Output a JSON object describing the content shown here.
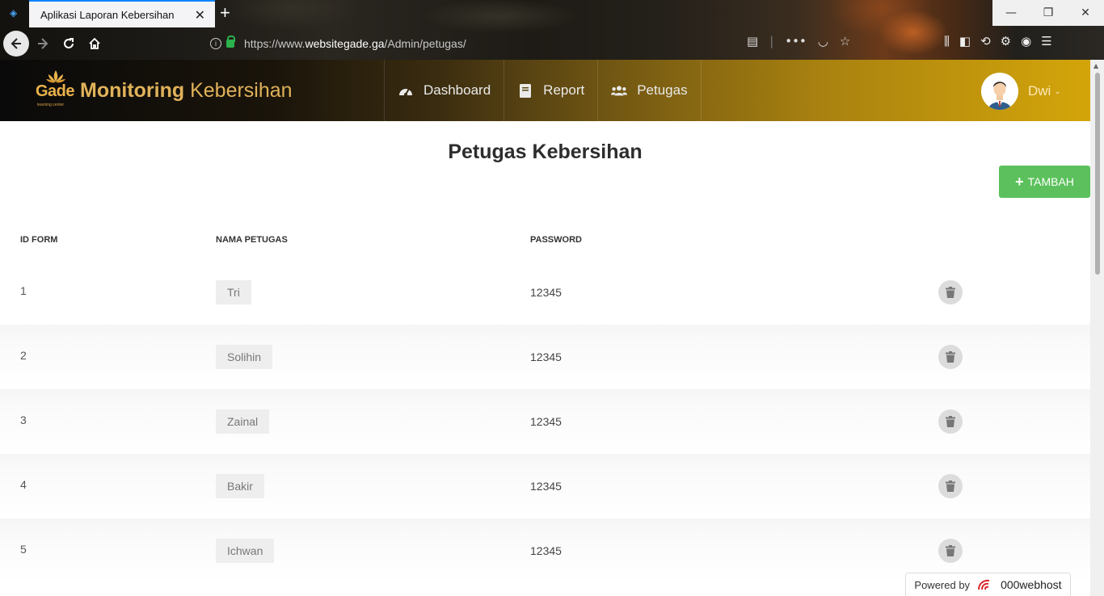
{
  "browser": {
    "tab_title": "Aplikasi Laporan Kebersihan",
    "url_prefix": "https://www.",
    "url_host": "websitegade.ga",
    "url_path": "/Admin/petugas/"
  },
  "header": {
    "logo_text": "Gade",
    "logo_subtext": "learning center",
    "brand_bold": "Monitoring",
    "brand_light": "Kebersihan",
    "nav": [
      {
        "label": "Dashboard",
        "icon": "dashboard-icon"
      },
      {
        "label": "Report",
        "icon": "book-icon"
      },
      {
        "label": "Petugas",
        "icon": "users-icon"
      }
    ],
    "user_name": "Dwi"
  },
  "main": {
    "title": "Petugas Kebersihan",
    "add_label": "TAMBAH",
    "columns": [
      "ID FORM",
      "NAMA PETUGAS",
      "PASSWORD"
    ],
    "rows": [
      {
        "id": "1",
        "name": "Tri",
        "password": "12345"
      },
      {
        "id": "2",
        "name": "Solihin",
        "password": "12345"
      },
      {
        "id": "3",
        "name": "Zainal",
        "password": "12345"
      },
      {
        "id": "4",
        "name": "Bakir",
        "password": "12345"
      },
      {
        "id": "5",
        "name": "Ichwan",
        "password": "12345"
      }
    ]
  },
  "footer": {
    "powered_label": "Powered by",
    "host_name": "000webhost"
  },
  "colors": {
    "accent_gold": "#d4a50a",
    "add_button": "#5cc15c",
    "tab_highlight": "#0a84ff"
  }
}
